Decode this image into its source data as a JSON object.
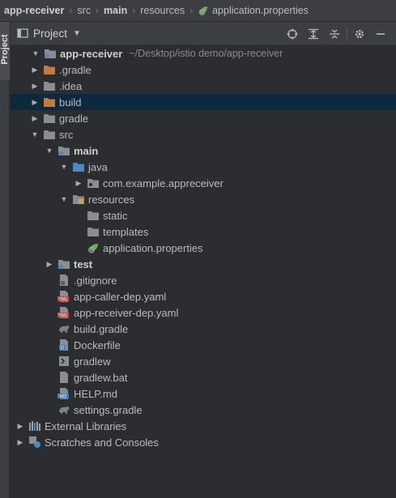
{
  "breadcrumb": {
    "items": [
      "app-receiver",
      "src",
      "main",
      "resources",
      "application.properties"
    ]
  },
  "tool_window": {
    "strip_label": "Project"
  },
  "panel": {
    "title": "Project",
    "tools": [
      "locate-icon",
      "expand-all-icon",
      "collapse-all-icon",
      "gear-icon",
      "hide-icon"
    ]
  },
  "tree": {
    "root": {
      "label": "app-receiver",
      "path": "~/Desktop/istio demo/app-receiver"
    },
    "items": [
      {
        "label": ".gradle"
      },
      {
        "label": ".idea"
      },
      {
        "label": "build"
      },
      {
        "label": "gradle"
      },
      {
        "label": "src"
      },
      {
        "label": "main"
      },
      {
        "label": "java"
      },
      {
        "label": "com.example.appreceiver"
      },
      {
        "label": "resources"
      },
      {
        "label": "static"
      },
      {
        "label": "templates"
      },
      {
        "label": "application.properties"
      },
      {
        "label": "test"
      },
      {
        "label": ".gitignore"
      },
      {
        "label": "app-caller-dep.yaml"
      },
      {
        "label": "app-receiver-dep.yaml"
      },
      {
        "label": "build.gradle"
      },
      {
        "label": "Dockerfile"
      },
      {
        "label": "gradlew"
      },
      {
        "label": "gradlew.bat"
      },
      {
        "label": "HELP.md"
      },
      {
        "label": "settings.gradle"
      },
      {
        "label": "External Libraries"
      },
      {
        "label": "Scratches and Consoles"
      }
    ]
  },
  "colors": {
    "background": "#2b2d30",
    "header": "#3c3f41",
    "selection": "#0d293e",
    "folder": "#8a8d91",
    "excluded_folder": "#c77a35",
    "source_folder": "#4a88c7"
  }
}
